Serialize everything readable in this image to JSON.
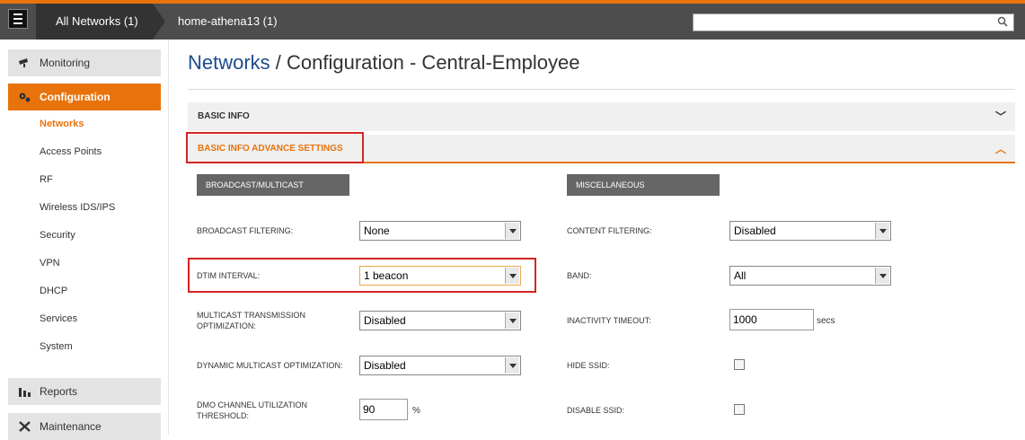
{
  "header": {
    "crumb_all_networks": "All Networks (1)",
    "crumb_network": "home-athena13 (1)",
    "search": {
      "placeholder": "",
      "value": ""
    }
  },
  "sidebar": {
    "monitoring": "Monitoring",
    "configuration": "Configuration",
    "items": [
      "Networks",
      "Access Points",
      "RF",
      "Wireless IDS/IPS",
      "Security",
      "VPN",
      "DHCP",
      "Services",
      "System"
    ],
    "reports": "Reports",
    "maintenance": "Maintenance"
  },
  "page": {
    "title_link": "Networks",
    "title_rest": " / Configuration - Central-Employee"
  },
  "accordion": {
    "basic_info": "BASIC INFO",
    "advance": "BASIC INFO ADVANCE SETTINGS"
  },
  "broadcast": {
    "heading": "BROADCAST/MULTICAST",
    "broadcast_filtering": {
      "label": "BROADCAST FILTERING:",
      "value": "None"
    },
    "dtim_interval": {
      "label": "DTIM INTERVAL:",
      "value": "1 beacon"
    },
    "multicast_opt": {
      "label_line1": "MULTICAST TRANSMISSION",
      "label_line2": "OPTIMIZATION:",
      "value": "Disabled"
    },
    "dynamic_multicast": {
      "label": "DYNAMIC MULTICAST OPTIMIZATION:",
      "value": "Disabled"
    },
    "dmo_threshold": {
      "label_line1": "DMO CHANNEL UTILIZATION",
      "label_line2": "THRESHOLD:",
      "value": "90",
      "unit": "%"
    }
  },
  "misc": {
    "heading": "MISCELLANEOUS",
    "content_filtering": {
      "label": "CONTENT FILTERING:",
      "value": "Disabled"
    },
    "band": {
      "label": "BAND:",
      "value": "All"
    },
    "inactivity_timeout": {
      "label": "INACTIVITY TIMEOUT:",
      "value": "1000",
      "unit": "secs"
    },
    "hide_ssid": {
      "label": "HIDE SSID:",
      "checked": false
    },
    "disable_ssid": {
      "label": "DISABLE SSID:",
      "checked": false
    }
  },
  "colors": {
    "accent": "#e8730d",
    "topbar": "#4d4d4d",
    "link": "#1d4a8c",
    "highlight": "#d42424"
  }
}
